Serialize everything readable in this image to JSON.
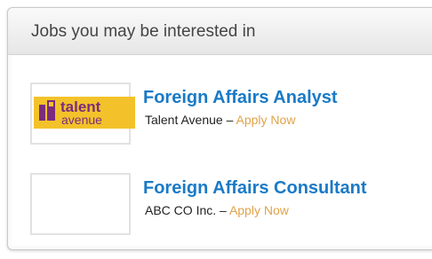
{
  "widget": {
    "title": "Jobs you may be interested in"
  },
  "jobs": [
    {
      "title": "Foreign Affairs Analyst",
      "company": "Talent Avenue",
      "separator": " – ",
      "apply": "Apply Now",
      "logo": {
        "icon": "talent-avenue-logo",
        "text_top": "talent",
        "text_bottom": "avenue",
        "bg": "#f3c22a",
        "accent": "#7b2c7e"
      }
    },
    {
      "title": "Foreign Affairs Consultant",
      "company": "ABC CO Inc.",
      "separator": " – ",
      "apply": "Apply Now",
      "logo": {
        "icon": "placeholder-logo"
      }
    }
  ],
  "colors": {
    "title_blue": "#1a7ac6",
    "apply_orange": "#e0a24a"
  }
}
